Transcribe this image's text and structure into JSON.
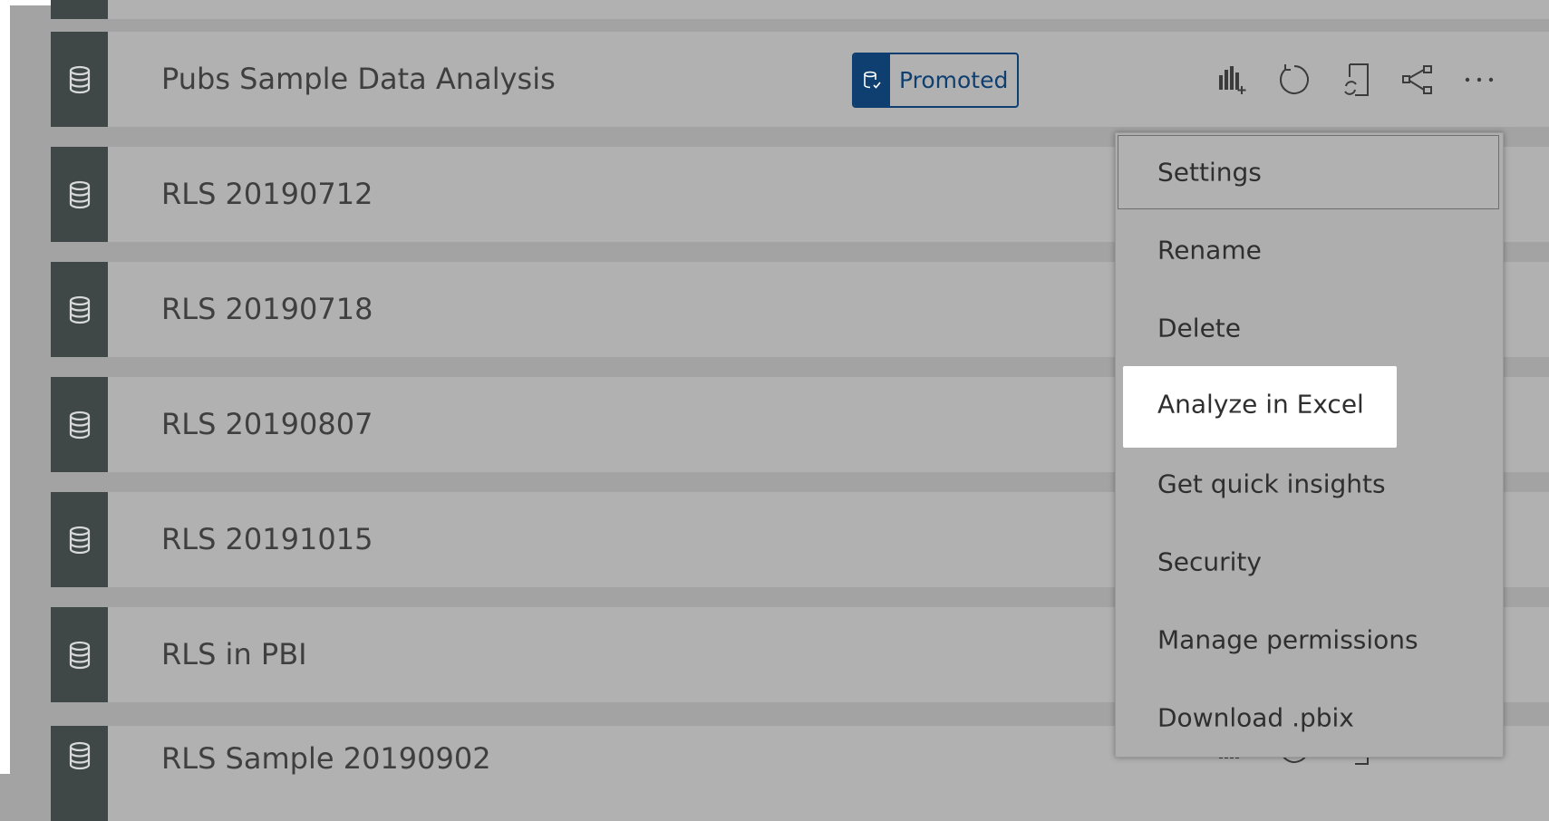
{
  "rows": [
    {
      "name": "",
      "has_badge": false
    },
    {
      "name": "Pubs Sample Data Analysis",
      "has_badge": true
    },
    {
      "name": "RLS 20190712"
    },
    {
      "name": "RLS 20190718"
    },
    {
      "name": "RLS 20190807"
    },
    {
      "name": "RLS 20191015"
    },
    {
      "name": "RLS in PBI"
    },
    {
      "name": "RLS Sample 20190902"
    }
  ],
  "badge": {
    "label": "Promoted"
  },
  "row_icons": [
    "database-icon"
  ],
  "action_icons": [
    "create-report-icon",
    "refresh-icon",
    "schedule-refresh-icon",
    "share-icon",
    "more-options-icon"
  ],
  "context_menu": {
    "items": [
      {
        "label": "Settings",
        "state": "focused"
      },
      {
        "label": "Rename"
      },
      {
        "label": "Delete"
      },
      {
        "label": "Analyze in Excel",
        "state": "highlighted"
      },
      {
        "label": "Get quick insights"
      },
      {
        "label": "Security"
      },
      {
        "label": "Manage permissions"
      },
      {
        "label": "Download .pbix"
      }
    ]
  },
  "colors": {
    "overlay": "#a3a3a3",
    "row": "#b1b1b1",
    "tile": "#404747",
    "badge": "#0e3f70",
    "highlight": "#ffffff"
  }
}
